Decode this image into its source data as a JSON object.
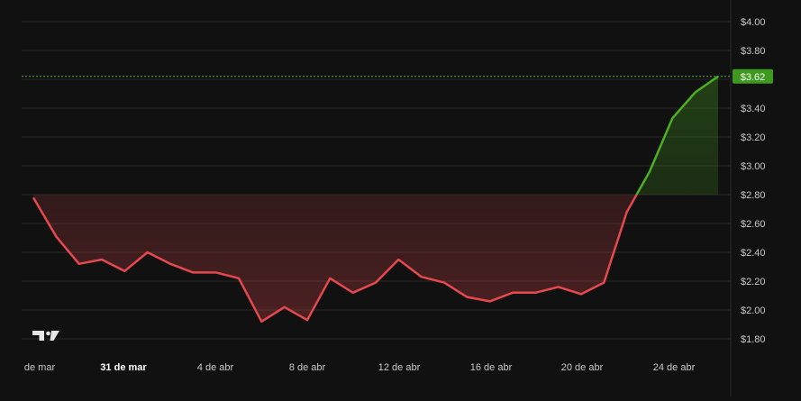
{
  "chart_data": {
    "type": "area",
    "y_axis_position": "right",
    "ylim": [
      1.7,
      4.1
    ],
    "y_ticks": [
      1.8,
      2.0,
      2.2,
      2.4,
      2.6,
      2.8,
      3.0,
      3.2,
      3.4,
      3.6,
      3.8,
      4.0
    ],
    "y_tick_labels": [
      "$1.80",
      "$2.00",
      "$2.20",
      "$2.40",
      "$2.60",
      "$2.80",
      "$3.00",
      "$3.20",
      "$3.40",
      "$3.60",
      "$3.80",
      "$4.00"
    ],
    "x_tick_labels": [
      {
        "label": "de mar",
        "bold": false
      },
      {
        "label": "31 de mar",
        "bold": true
      },
      {
        "label": "4 de abr",
        "bold": false
      },
      {
        "label": "8 de abr",
        "bold": false
      },
      {
        "label": "12 de abr",
        "bold": false
      },
      {
        "label": "16 de abr",
        "bold": false
      },
      {
        "label": "20 de abr",
        "bold": false
      },
      {
        "label": "24 de abr",
        "bold": false
      }
    ],
    "baseline": 2.8,
    "current_value": 3.62,
    "current_value_label": "$3.62",
    "grid": true,
    "series": [
      {
        "values": [
          2.78,
          2.51,
          2.32,
          2.35,
          2.27,
          2.4,
          2.32,
          2.26,
          2.26,
          2.22,
          1.92,
          2.02,
          1.93,
          2.22,
          2.12,
          2.19,
          2.35,
          2.23,
          2.19,
          2.09,
          2.06,
          2.12,
          2.12,
          2.16,
          2.11,
          2.19,
          2.68,
          2.96,
          3.33,
          3.51,
          3.62
        ]
      }
    ],
    "colors": {
      "above_baseline": "#4caf22",
      "below_baseline": "#e5484d",
      "current_label_bg": "#3d9a1f",
      "grid": "#262626",
      "axis_text": "#c8c8c8",
      "background": "#111111"
    }
  },
  "logo": {
    "name": "tradingview-logo",
    "text": "TV"
  }
}
